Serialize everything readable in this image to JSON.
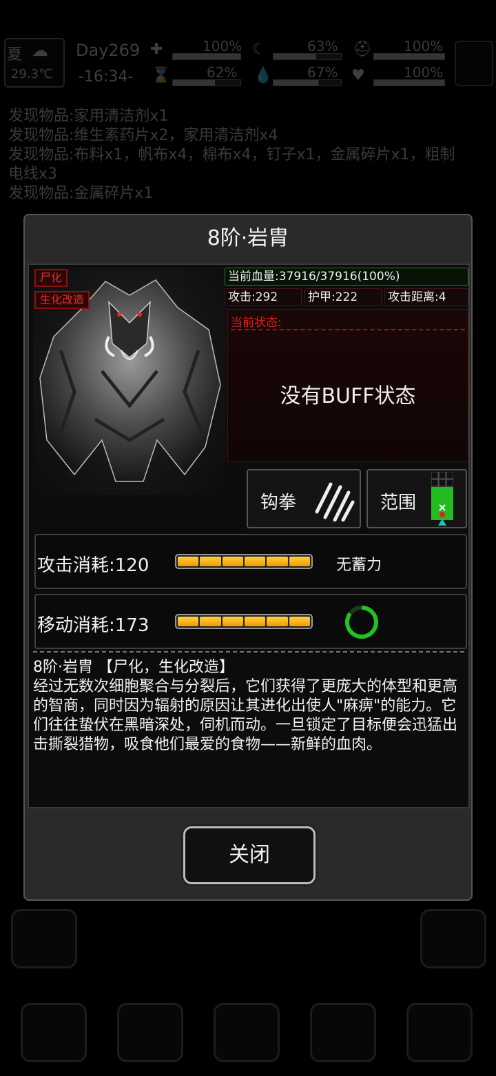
{
  "hud": {
    "season": "夏",
    "day": "Day269",
    "temperature": "29.3℃",
    "time": "-16:34-",
    "stats": [
      {
        "name": "health",
        "value": "100%",
        "level": 1.0
      },
      {
        "name": "fatigue",
        "value": "63%",
        "level": 0.63
      },
      {
        "name": "armor",
        "value": "100%",
        "level": 1.0
      },
      {
        "name": "stamina",
        "value": "62%",
        "level": 0.62
      },
      {
        "name": "thirst",
        "value": "67%",
        "level": 0.67
      },
      {
        "name": "mood",
        "value": "100%",
        "level": 1.0
      }
    ]
  },
  "log": [
    "发现物品:家用清洁剂x1",
    "发现物品:维生素药片x2，家用清洁剂x4",
    "发现物品:布料x1，帆布x4，棉布x4，钉子x1，金属碎片x1，粗制",
    "电线x3",
    "发现物品:金属碎片x1"
  ],
  "dialog": {
    "title": "8阶·岩胄",
    "tags": [
      "尸化",
      "生化改造"
    ],
    "hp": "当前血量:37916/37916(100%)",
    "attack": "攻击:292",
    "armor": "护甲:222",
    "range": "攻击距离:4",
    "status_label": "当前状态:",
    "status_empty": "没有BUFF状态",
    "skills": [
      {
        "label": "钩拳",
        "icon": "claw-icon"
      },
      {
        "label": "范围",
        "icon": "range-grid-icon"
      }
    ],
    "attack_cost": {
      "label": "攻击消耗:120",
      "charge": "无蓄力",
      "segments": 6,
      "filled": 6
    },
    "move_cost": {
      "label": "移动消耗:173",
      "segments": 6,
      "filled": 6,
      "ring_progress": 0.85
    },
    "description_title": "8阶·岩胄 【尸化，生化改造】",
    "description": "经过无数次细胞聚合与分裂后，它们获得了更庞大的体型和更高的智商，同时因为辐射的原因让其进化出使人\"麻痹\"的能力。它们往往蛰伏在黑暗深处，伺机而动。一旦锁定了目标便会迅猛出击撕裂猎物，吸食他们最爱的食物——新鲜的血肉。",
    "close": "关闭"
  },
  "colors": {
    "accent_red": "#d42222",
    "bar_orange": "#f29a00",
    "ring_green": "#22c022"
  }
}
